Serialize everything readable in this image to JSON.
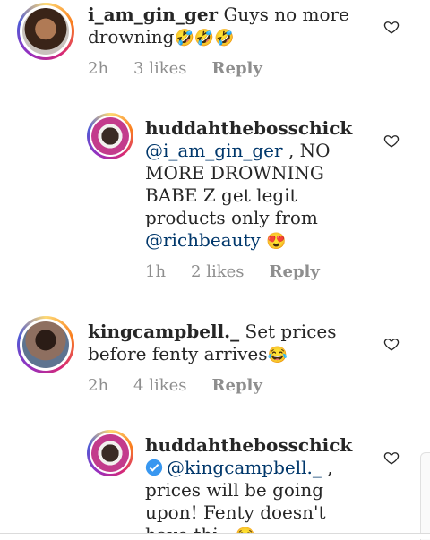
{
  "comments": [
    {
      "username": "i_am_gin_ger",
      "text": "Guys no more drowning",
      "emoji": "🤣🤣🤣",
      "time": "2h",
      "likes": "3 likes",
      "reply": "Reply"
    },
    {
      "username": "huddahthebosschick",
      "mention": "@i_am_gin_ger",
      "text": ", NO MORE DROWNING BABE Z get legit products only from",
      "mention2": "@richbeauty",
      "emoji": "😍",
      "time": "1h",
      "likes": "2 likes",
      "reply": "Reply"
    },
    {
      "username": "kingcampbell._",
      "text": "Set prices before fenty arrives",
      "emoji": "😂",
      "time": "2h",
      "likes": "4 likes",
      "reply": "Reply"
    },
    {
      "username": "huddahthebosschick",
      "mention": "@kingcampbell._",
      "text": ", prices will be going upon! Fenty doesn't have",
      "text_cut": "thi...",
      "emoji": "😂"
    }
  ],
  "colors": {
    "mention": "#00376b",
    "meta": "#8e8e8e",
    "verified": "#3897f0"
  }
}
